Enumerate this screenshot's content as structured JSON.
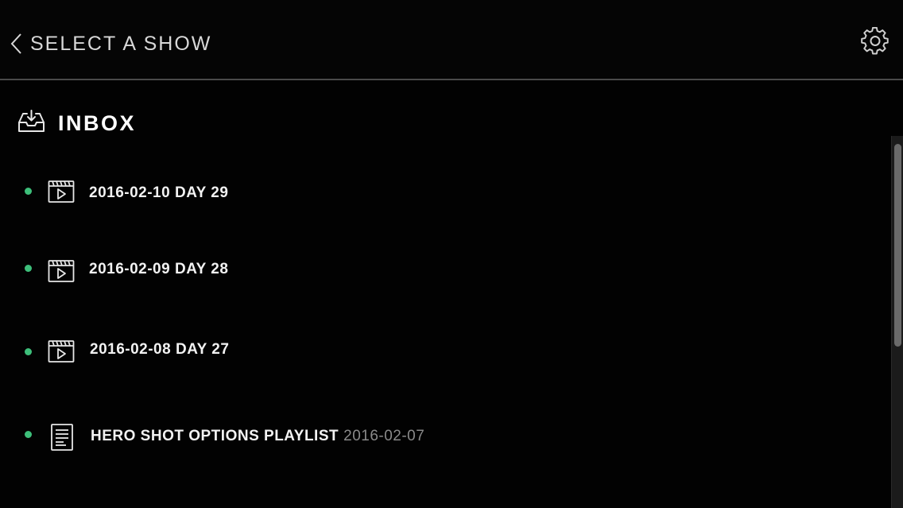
{
  "header": {
    "back_label": "SELECT A SHOW"
  },
  "inbox": {
    "title": "INBOX"
  },
  "items": [
    {
      "title": "2016-02-10 DAY 29",
      "date": "",
      "type": "clip",
      "status": "new"
    },
    {
      "title": "2016-02-09 DAY 28",
      "date": "",
      "type": "clip",
      "status": "new"
    },
    {
      "title": "2016-02-08 DAY 27",
      "date": "",
      "type": "clip",
      "status": "new"
    },
    {
      "title": "HERO SHOT OPTIONS PLAYLIST",
      "date": "2016-02-07",
      "type": "playlist",
      "status": "new"
    }
  ],
  "colors": {
    "background": "#020202",
    "status_dot": "#3dbf7a",
    "divider": "#4a4a4a",
    "secondary_text": "#8a8a8a"
  },
  "icons": {
    "back": "chevron-left-icon",
    "settings": "gear-icon",
    "inbox": "inbox-tray-icon",
    "clip": "clapperboard-play-icon",
    "playlist": "document-list-icon"
  }
}
